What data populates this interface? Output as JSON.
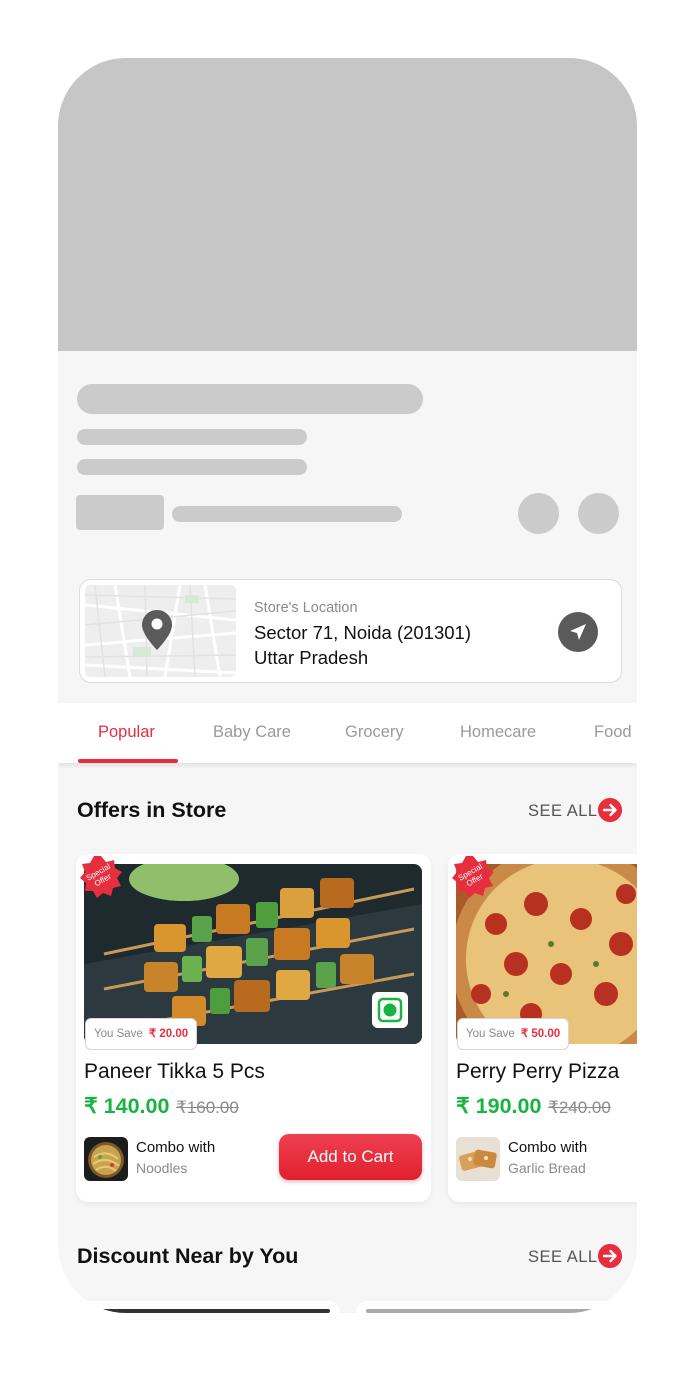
{
  "store_location": {
    "label": "Store's Location",
    "line1": "Sector 71, Noida (201301)",
    "line2": "Uttar Pradesh"
  },
  "tabs": [
    {
      "label": "Popular",
      "active": true
    },
    {
      "label": "Baby Care"
    },
    {
      "label": "Grocery"
    },
    {
      "label": "Homecare"
    },
    {
      "label": "Food"
    }
  ],
  "offers": {
    "title": "Offers in Store",
    "see_all": "SEE ALL",
    "items": [
      {
        "badge": "Special Offer",
        "save_label": "You Save",
        "save_amount": "₹ 20.00",
        "name": "Paneer Tikka 5 Pcs",
        "price": "₹ 140.00",
        "mrp": "₹160.00",
        "combo_label": "Combo with",
        "combo_item": "Noodles",
        "add_label": "Add to Cart"
      },
      {
        "badge": "Special Offer",
        "save_label": "You Save",
        "save_amount": "₹ 50.00",
        "name": "Perry Perry Pizza",
        "price": "₹ 190.00",
        "mrp": "₹240.00",
        "combo_label": "Combo with",
        "combo_item": "Garlic Bread"
      }
    ]
  },
  "discount": {
    "title": "Discount Near by You",
    "see_all": "SEE ALL"
  },
  "colors": {
    "accent": "#e62e3f",
    "price_green": "#19b344",
    "skeleton": "#cbcbcb"
  }
}
